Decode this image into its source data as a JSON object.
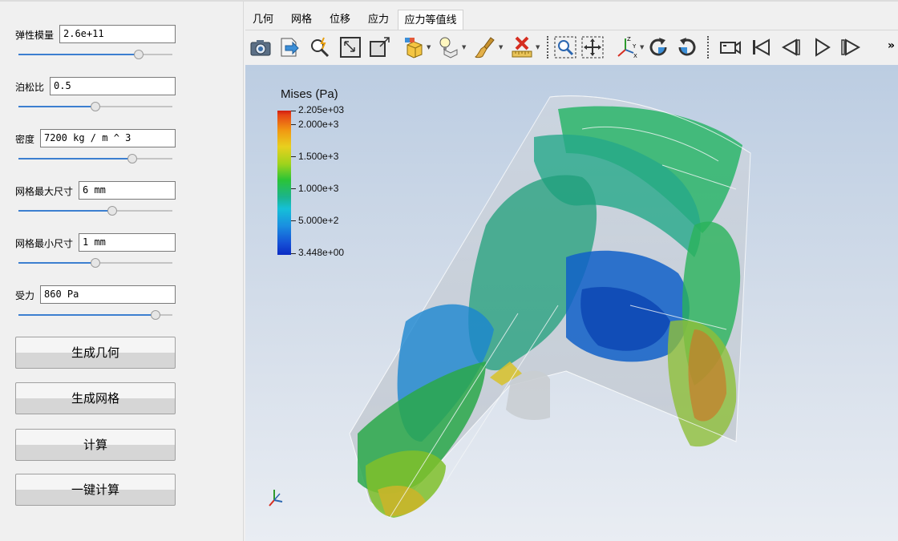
{
  "params": [
    {
      "label": "弹性模量",
      "value": "2.6e+11",
      "slider": 0.78
    },
    {
      "label": "泊松比",
      "value": "0.5",
      "slider": 0.5
    },
    {
      "label": "密度",
      "value": "7200 kg / m ^ 3",
      "slider": 0.74
    },
    {
      "label": "网格最大尺寸",
      "value": "6 mm",
      "slider": 0.61
    },
    {
      "label": "网格最小尺寸",
      "value": "1 mm",
      "slider": 0.5
    },
    {
      "label": "受力",
      "value": "860 Pa",
      "slider": 0.89
    }
  ],
  "buttons": {
    "generate_geometry": "生成几何",
    "generate_mesh": "生成网格",
    "compute": "计算",
    "one_click_compute": "一键计算"
  },
  "tabs": [
    "几何",
    "网格",
    "位移",
    "应力",
    "应力等值线"
  ],
  "active_tab": "应力等值线",
  "toolbar": {
    "icons": [
      "camera-icon",
      "export-icon",
      "probe-icon",
      "fit-view-icon",
      "outline-icon",
      "box-color-icon",
      "light-bulb-icon",
      "clip-icon",
      "brush-icon",
      "clear-icon",
      "ruler-icon",
      "zoom-box-icon",
      "pan-icon",
      "axes-icon",
      "rotate-cw-icon",
      "rotate-ccw-icon",
      "record-icon",
      "first-frame-icon",
      "prev-frame-icon",
      "play-icon",
      "last-frame-icon"
    ],
    "more": "»"
  },
  "legend": {
    "title": "Mises (Pa)",
    "labels": [
      "2.205e+03",
      "2.000e+3",
      "1.500e+3",
      "1.000e+3",
      "5.000e+2",
      "3.448e+00"
    ]
  },
  "colors": {
    "slider_fill": "#3c7fd0",
    "viewport_top": "#bccde2",
    "viewport_bottom": "#e9edf3"
  }
}
